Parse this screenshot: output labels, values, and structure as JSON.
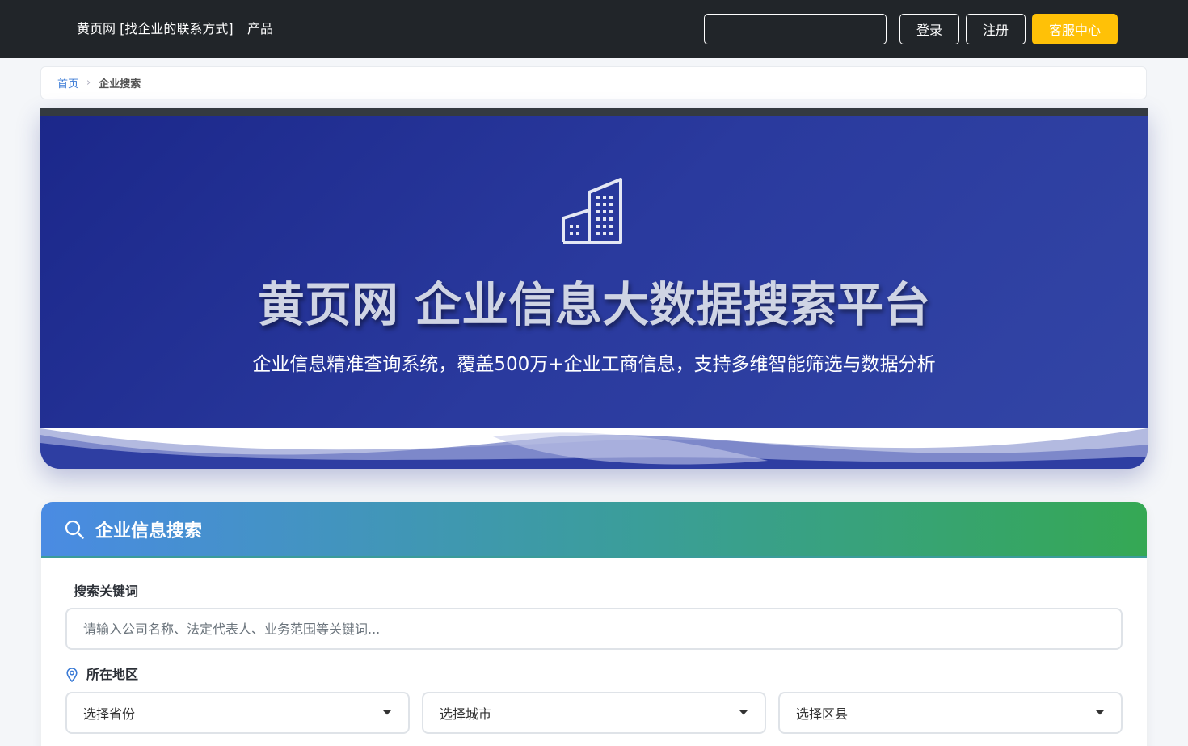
{
  "nav": {
    "brand": "黄页网  [找企业的联系方式]",
    "products_link": "产品",
    "search_placeholder": "",
    "login": "登录",
    "register": "注册",
    "support": "客服中心"
  },
  "breadcrumb": {
    "home": "首页",
    "separator": "›",
    "current": "企业搜索"
  },
  "hero": {
    "icon": "building-icon",
    "title": "黄页网 企业信息大数据搜索平台",
    "subtitle": "企业信息精准查询系统，覆盖500万+企业工商信息，支持多维智能筛选与数据分析"
  },
  "search_card": {
    "title": "企业信息搜索",
    "keyword_label": "搜索关键词",
    "keyword_placeholder": "请输入公司名称、法定代表人、业务范围等关键词...",
    "region_label": "所在地区",
    "province": "选择省份",
    "city": "选择城市",
    "district": "选择区县"
  },
  "colors": {
    "nav_bg": "#212529",
    "accent_yellow": "#ffc107",
    "hero_blue": "#2a3a9e",
    "link_blue": "#3b7bd6",
    "card_gradient_start": "#4a8be3",
    "card_gradient_end": "#35a854"
  }
}
